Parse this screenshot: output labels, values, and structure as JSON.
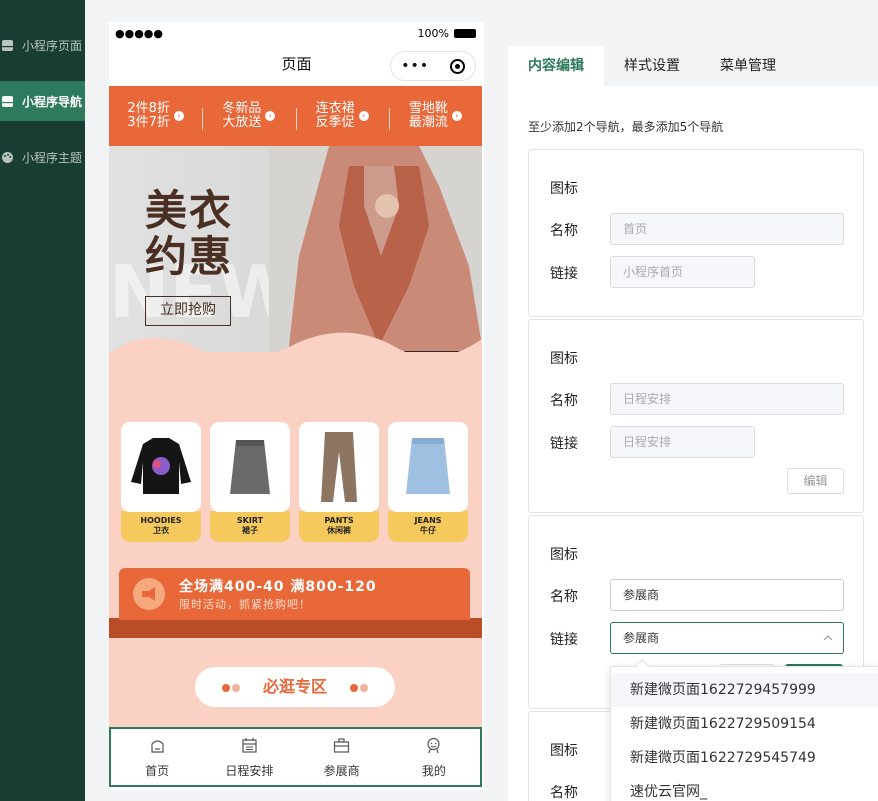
{
  "sidebar": {
    "items": [
      {
        "label": "小程序页面"
      },
      {
        "label": "小程序导航"
      },
      {
        "label": "小程序主题"
      }
    ]
  },
  "phone": {
    "status": {
      "signal": "●●●●●",
      "battery": "100%"
    },
    "title": "页面",
    "capsule": {
      "more": "•••"
    },
    "promo": [
      {
        "line1": "2件8折",
        "line2": "3件7折"
      },
      {
        "line1": "冬新品",
        "line2": "大放送"
      },
      {
        "line1": "连衣裙",
        "line2": "反季促"
      },
      {
        "line1": "雪地靴",
        "line2": "最潮流"
      }
    ],
    "hero": {
      "title_line1": "美衣",
      "title_line2": "约惠",
      "bg_text": "NEW",
      "button": "立即抢购"
    },
    "products": [
      {
        "en": "HOODIES",
        "cn": "卫衣"
      },
      {
        "en": "SKIRT",
        "cn": "裙子"
      },
      {
        "en": "PANTS",
        "cn": "休闲裤"
      },
      {
        "en": "JEANS",
        "cn": "牛仔"
      }
    ],
    "coupon": {
      "main": "全场满400-40 满800-120",
      "sub": "限时活动，抓紧抢购吧！"
    },
    "must": "必逛专区",
    "tabbar": [
      {
        "label": "首页",
        "icon": "home-icon"
      },
      {
        "label": "日程安排",
        "icon": "calendar-icon"
      },
      {
        "label": "参展商",
        "icon": "briefcase-icon"
      },
      {
        "label": "我的",
        "icon": "user-icon"
      }
    ]
  },
  "panel": {
    "tabs": [
      {
        "label": "内容编辑"
      },
      {
        "label": "样式设置"
      },
      {
        "label": "菜单管理"
      }
    ],
    "hint": "至少添加2个导航，最多添加5个导航",
    "labels": {
      "icon": "图标",
      "name": "名称",
      "link": "链接"
    },
    "cards": [
      {
        "name": "首页",
        "link": "小程序首页"
      },
      {
        "name": "日程安排",
        "link": "日程安排",
        "edit": "编辑"
      },
      {
        "name": "参展商",
        "link": "参展商"
      }
    ],
    "dropdown": [
      "新建微页面1622729457999",
      "新建微页面1622729509154",
      "新建微页面1622729545749",
      "速优云官网_"
    ]
  },
  "colors": {
    "accent": "#2e7a5c",
    "sidebar": "#193d32",
    "promo": "#e8683a"
  }
}
